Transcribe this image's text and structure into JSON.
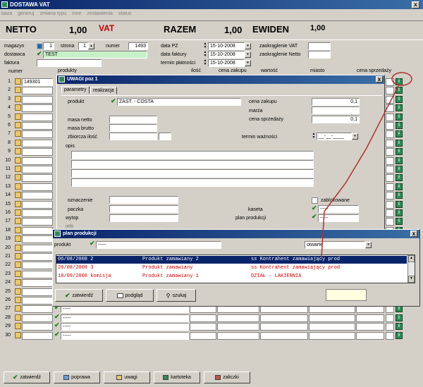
{
  "window": {
    "title": "DOSTAWA VAT",
    "close": "x"
  },
  "menu": [
    "baza",
    "generuj",
    "zmiana typu",
    "inne",
    "zestawienia",
    "status"
  ],
  "summary": {
    "netto_label": "NETTO",
    "netto_value": "1,00",
    "vat_label": "VAT",
    "razem_label": "RAZEM",
    "razem_value": "1,00",
    "ewiden_label": "EWIDEN",
    "ewiden_value": "1,00"
  },
  "header": {
    "magazyn_label": "magazyn",
    "magazyn_value": "1",
    "strona_label": "strona",
    "strona_value": "1",
    "numer_label": "numer",
    "numer_value": "1493",
    "dostawca_label": "dostawca",
    "dostawca_value": "TEST",
    "faktura_label": "faktura",
    "data_pz_label": "data PZ",
    "data_pz_value": "15-10-2008",
    "data_faktury_label": "data faktury",
    "data_faktury_value": "15-10-2008",
    "termin_label": "termin płatności",
    "termin_value": "15-10-2008",
    "zaok_vat_label": "zaokrąglenie VAT",
    "zaok_netto_label": "zaokrąglenie Netto"
  },
  "grid": {
    "columns": [
      "numer",
      "produkty",
      "ilość",
      "cena zakupu",
      "wartość",
      "miasto",
      "cena sprzedaży"
    ],
    "first_row_number": "149301",
    "row_numbers": [
      "1",
      "2",
      "3",
      "4",
      "5",
      "6",
      "7",
      "8",
      "9",
      "10",
      "11",
      "12",
      "13",
      "14",
      "15",
      "16",
      "17",
      "18",
      "19",
      "20",
      "21",
      "22",
      "23",
      "24",
      "25",
      "26",
      "27",
      "28",
      "29",
      "30"
    ],
    "row_placeholder": "-----",
    "vis_value": "0"
  },
  "uwagi": {
    "title": "UWAGI poz  1",
    "tabs": [
      "parametry",
      "realizacja"
    ],
    "produkt_label": "produkt",
    "produkt_value": "ZAST. - COSTA",
    "cena_zakupu_label": "cena zakupu",
    "cena_zakupu_value": "0,1",
    "marza_label": "marża",
    "cena_sprzedazy_label": "cena sprzedaży",
    "cena_sprzedazy_value": "0,1",
    "masa_netto_label": "masa netto",
    "masa_brutto_label": "masa brutto",
    "zbiorcza_label": "zbiorcza ilość",
    "termin_waznosci_label": "termin ważności",
    "termin_waznosci_value": "__-__-____",
    "opis_label": "opis",
    "oznaczenie_label": "oznaczenie",
    "paczka_label": "paczka",
    "wytop_label": "wytop",
    "info_label": "info",
    "zablokowane_label": "zablokowane",
    "kaseta_label": "kaseta",
    "kaseta_value": "-----",
    "plan_label": "plan produkcji",
    "plan_value": "-----"
  },
  "plan": {
    "title": "plan produkcji",
    "produkt_label": "produkt",
    "produkt_value": "-----",
    "filter_value": "otwarte",
    "rows": [
      [
        "06/08/2008 2",
        "Produkt zamawiany 2",
        "ss Kontrahent zamawiający prod"
      ],
      [
        "20/08/2008 3",
        "Produkt zamawiany",
        "ss Kontrahent zamawiający prod"
      ],
      [
        "18/09/2008 komisja",
        "Produkt zamawiany 1",
        "DZIAŁ - LAKIERNIA"
      ]
    ],
    "buttons": [
      "zatwierdź",
      "podgląd",
      "szukaj"
    ]
  },
  "bottom_buttons": [
    "zatwierdź",
    "poprawa",
    "uwagi",
    "kartoteka",
    "zaliczki"
  ],
  "colors": {
    "titlebar": "#0a246a",
    "selected_row": "#0a246a",
    "red_text": "#cc0000",
    "vat_red": "#c00000",
    "annotation": "#b03030"
  }
}
